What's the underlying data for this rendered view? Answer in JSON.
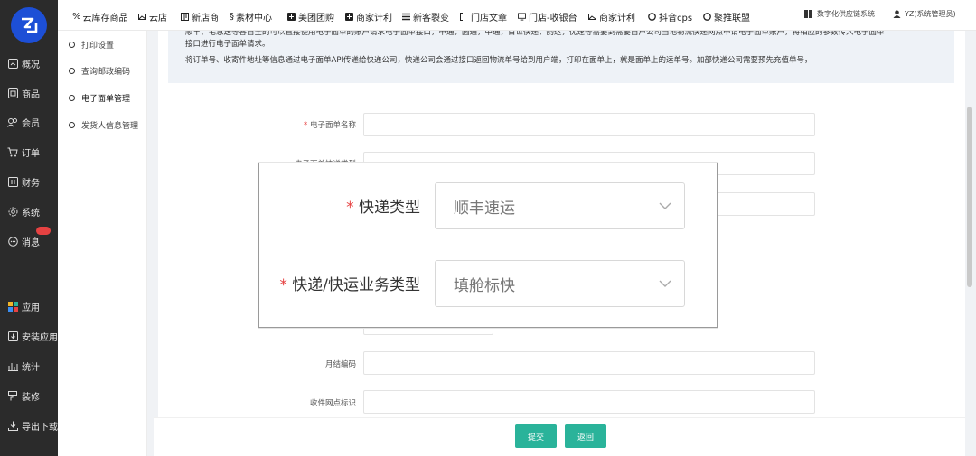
{
  "sidebar": {
    "items": [
      {
        "label": "概况",
        "icon": "dashboard-icon"
      },
      {
        "label": "商品",
        "icon": "goods-icon"
      },
      {
        "label": "会员",
        "icon": "members-icon"
      },
      {
        "label": "订单",
        "icon": "cart-icon"
      },
      {
        "label": "财务",
        "icon": "finance-icon"
      },
      {
        "label": "系统",
        "icon": "gear-icon"
      },
      {
        "label": "消息",
        "icon": "message-icon"
      },
      {
        "label": "应用",
        "icon": "apps-icon"
      },
      {
        "label": "安装应用",
        "icon": "install-icon"
      },
      {
        "label": "统计",
        "icon": "stats-icon"
      },
      {
        "label": "装修",
        "icon": "decorate-icon"
      },
      {
        "label": "导出下载",
        "icon": "download-icon"
      }
    ]
  },
  "topnav": {
    "items": [
      {
        "label": "云库存商品"
      },
      {
        "label": "云店"
      },
      {
        "label": "新店商"
      },
      {
        "label": "素材中心"
      },
      {
        "label": "美团团购"
      },
      {
        "label": "商家计利"
      },
      {
        "label": "新客裂变"
      },
      {
        "label": "门店文章"
      },
      {
        "label": "门店-收银台"
      },
      {
        "label": "商家计利"
      },
      {
        "label": "抖音cps"
      },
      {
        "label": "聚推联盟"
      }
    ],
    "system_label": "数字化供应链系统",
    "user_label": "YZ(系统管理员)"
  },
  "subnav": {
    "items": [
      {
        "label": "打印设置"
      },
      {
        "label": "查询邮政编码"
      },
      {
        "label": "电子面单管理"
      },
      {
        "label": "发货人信息管理"
      }
    ]
  },
  "notice": {
    "line1": "顺丰、宅急送等各自全的可以直接使用电子面单的账户请求电子面单接口，申通，圆通，中通，百世快递，韵达，优速等需要到需要自户公司当地物流快递网点申请电子面单账户，将相应的参数传入电子面单",
    "line2": "接口进行电子面单请求。",
    "line3": "将订单号、收寄件地址等信息通过电子面单API传递给快递公司，快递公司会通过接口返回物流单号给到用户端，打印在面单上，就是面单上的运单号。加部快递公司需要预先充值单号，"
  },
  "form": {
    "name_label": "电子面单名称",
    "type_label_partial": "电子面单快递类型",
    "account_label": "月结编码",
    "site_label": "收件网点标识"
  },
  "callout": {
    "express_type_label": "快递类型",
    "express_type_value": "顺丰速运",
    "business_type_label": "快递/快运业务类型",
    "business_type_value": "填舱标快"
  },
  "buttons": {
    "submit": "提交",
    "back": "返回"
  },
  "colors": {
    "accent": "#2ab39a",
    "sidebar_bg": "#2b2b2b",
    "required": "#e64242",
    "logo": "#1d4fd6"
  }
}
